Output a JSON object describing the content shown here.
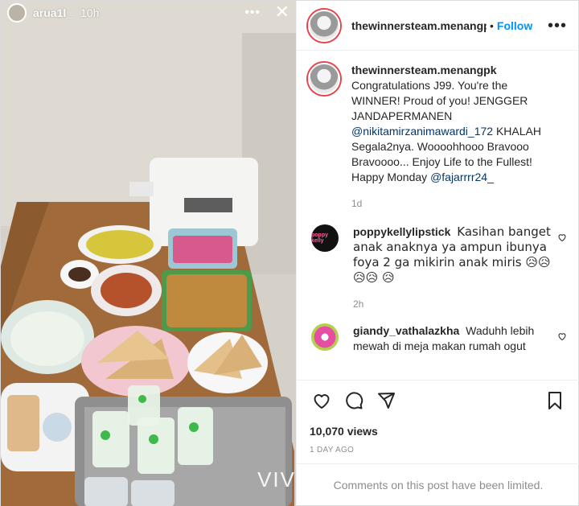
{
  "story": {
    "username": "arua1l_",
    "time": "10h",
    "more_label": "•••",
    "close_label": "✕",
    "watermark": "VIV"
  },
  "post": {
    "author": "thewinnersteam.menangpk",
    "header_username": "thewinnersteam.menangp",
    "dot": "•",
    "follow_label": "Follow",
    "more_label": "•••",
    "caption": {
      "username": "thewinnersteam.menangpk",
      "text_1": "Congratulations J99. You're the WINNER! Proud of you! JENGGER JANDAPERMANEN ",
      "mention_1": "@nikitamirzanimawardi_172",
      "text_2": " KHALAH Segala2nya. Woooohhooo Bravooo Bravoooo... Enjoy Life to the Fullest! Happy Monday ",
      "mention_2": "@fajarrrr24_",
      "time": "1d"
    },
    "comments": [
      {
        "username": "poppykellylipstick",
        "avatar_text": "poppy kelly",
        "text": "Kasihan banget anak anaknya ya ampun ibunya foya 2 ga mikirin anak miris 😥😥😥😥 😥",
        "time": "2h"
      },
      {
        "username": "giandy_vathalazkha",
        "text": "Waduhh lebih mewah di meja makan rumah ogut"
      }
    ],
    "views": "10,070 views",
    "date": "1 DAY AGO",
    "comments_limited": "Comments on this post have been limited."
  }
}
